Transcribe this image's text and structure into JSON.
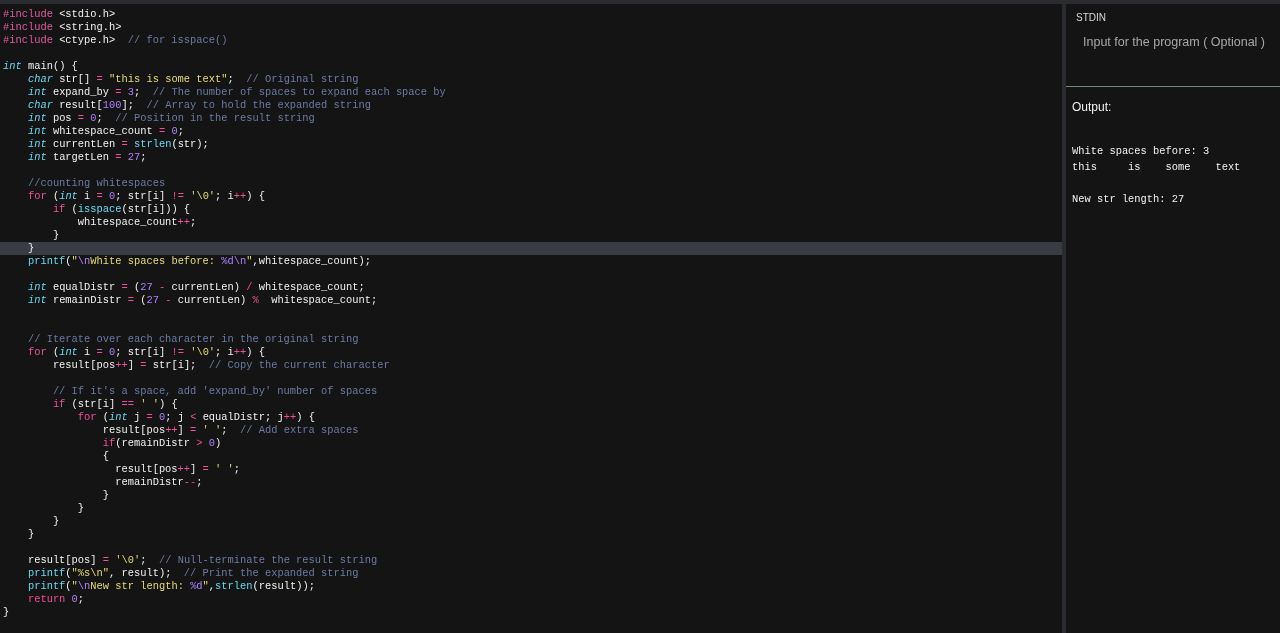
{
  "editor": {
    "lines": [
      {
        "highlighted": false,
        "tokens": [
          {
            "kind": "pp",
            "text": "#include"
          },
          {
            "kind": "plain",
            "text": " <stdio.h>"
          }
        ]
      },
      {
        "highlighted": false,
        "tokens": [
          {
            "kind": "pp",
            "text": "#include"
          },
          {
            "kind": "plain",
            "text": " <string.h>"
          }
        ]
      },
      {
        "highlighted": false,
        "tokens": [
          {
            "kind": "pp",
            "text": "#include"
          },
          {
            "kind": "plain",
            "text": " <ctype.h>  "
          },
          {
            "kind": "comment",
            "text": "// for isspace()"
          }
        ]
      },
      {
        "highlighted": false
      },
      {
        "highlighted": false,
        "tokens": [
          {
            "kind": "type",
            "text": "int"
          },
          {
            "kind": "plain",
            "text": " main() {"
          }
        ]
      },
      {
        "highlighted": false,
        "tokens": [
          {
            "kind": "type",
            "text": "    char"
          },
          {
            "kind": "plain",
            "text": " str[] "
          },
          {
            "kind": "op",
            "text": "="
          },
          {
            "kind": "string",
            "text": " \"this is some text\""
          },
          {
            "kind": "plain",
            "text": ";  "
          },
          {
            "kind": "comment",
            "text": "// Original string"
          }
        ]
      },
      {
        "highlighted": false,
        "tokens": [
          {
            "kind": "type",
            "text": "    int"
          },
          {
            "kind": "plain",
            "text": " expand_by "
          },
          {
            "kind": "op",
            "text": "="
          },
          {
            "kind": "number",
            "text": " 3"
          },
          {
            "kind": "plain",
            "text": ";  "
          },
          {
            "kind": "comment",
            "text": "// The number of spaces to expand each space by"
          }
        ]
      },
      {
        "highlighted": false,
        "tokens": [
          {
            "kind": "type",
            "text": "    char"
          },
          {
            "kind": "plain",
            "text": " result["
          },
          {
            "kind": "number",
            "text": "100"
          },
          {
            "kind": "plain",
            "text": "];  "
          },
          {
            "kind": "comment",
            "text": "// Array to hold the expanded string"
          }
        ]
      },
      {
        "highlighted": false,
        "tokens": [
          {
            "kind": "type",
            "text": "    int"
          },
          {
            "kind": "plain",
            "text": " pos "
          },
          {
            "kind": "op",
            "text": "="
          },
          {
            "kind": "number",
            "text": " 0"
          },
          {
            "kind": "plain",
            "text": ";  "
          },
          {
            "kind": "comment",
            "text": "// Position in the result string"
          }
        ]
      },
      {
        "highlighted": false,
        "tokens": [
          {
            "kind": "type",
            "text": "    int"
          },
          {
            "kind": "plain",
            "text": " whitespace_count "
          },
          {
            "kind": "op",
            "text": "="
          },
          {
            "kind": "number",
            "text": " 0"
          },
          {
            "kind": "plain",
            "text": ";"
          }
        ]
      },
      {
        "highlighted": false,
        "tokens": [
          {
            "kind": "type",
            "text": "    int"
          },
          {
            "kind": "plain",
            "text": " currentLen "
          },
          {
            "kind": "op",
            "text": "="
          },
          {
            "kind": "function",
            "text": " strlen"
          },
          {
            "kind": "plain",
            "text": "(str);"
          }
        ]
      },
      {
        "highlighted": false,
        "tokens": [
          {
            "kind": "type",
            "text": "    int"
          },
          {
            "kind": "plain",
            "text": " targetLen "
          },
          {
            "kind": "op",
            "text": "="
          },
          {
            "kind": "number",
            "text": " 27"
          },
          {
            "kind": "plain",
            "text": ";"
          }
        ]
      },
      {
        "highlighted": false
      },
      {
        "highlighted": false,
        "tokens": [
          {
            "kind": "comment",
            "text": "    //counting whitespaces"
          }
        ]
      },
      {
        "highlighted": false,
        "tokens": [
          {
            "kind": "keyword",
            "text": "    for"
          },
          {
            "kind": "plain",
            "text": " ("
          },
          {
            "kind": "type",
            "text": "int"
          },
          {
            "kind": "plain",
            "text": " i "
          },
          {
            "kind": "op",
            "text": "="
          },
          {
            "kind": "number",
            "text": " 0"
          },
          {
            "kind": "plain",
            "text": "; str[i] "
          },
          {
            "kind": "op",
            "text": "!="
          },
          {
            "kind": "string",
            "text": " '\\0'"
          },
          {
            "kind": "plain",
            "text": "; i"
          },
          {
            "kind": "op",
            "text": "++"
          },
          {
            "kind": "plain",
            "text": ") {"
          }
        ]
      },
      {
        "highlighted": false,
        "tokens": [
          {
            "kind": "keyword",
            "text": "        if"
          },
          {
            "kind": "plain",
            "text": " ("
          },
          {
            "kind": "function",
            "text": "isspace"
          },
          {
            "kind": "plain",
            "text": "(str[i])) {"
          }
        ]
      },
      {
        "highlighted": false,
        "tokens": [
          {
            "kind": "plain",
            "text": "            whitespace_count"
          },
          {
            "kind": "op",
            "text": "++"
          },
          {
            "kind": "plain",
            "text": ";"
          }
        ]
      },
      {
        "highlighted": false,
        "tokens": [
          {
            "kind": "plain",
            "text": "        }"
          }
        ]
      },
      {
        "highlighted": true,
        "tokens": [
          {
            "kind": "plain",
            "text": "    }"
          }
        ]
      },
      {
        "highlighted": false,
        "tokens": [
          {
            "kind": "function",
            "text": "    printf"
          },
          {
            "kind": "plain",
            "text": "("
          },
          {
            "kind": "string",
            "text": "\""
          },
          {
            "kind": "escape",
            "text": "\\n"
          },
          {
            "kind": "string",
            "text": "White spaces before: "
          },
          {
            "kind": "escape",
            "text": "%d\\n"
          },
          {
            "kind": "string",
            "text": "\""
          },
          {
            "kind": "plain",
            "text": ",whitespace_count);"
          }
        ]
      },
      {
        "highlighted": false
      },
      {
        "highlighted": false,
        "tokens": [
          {
            "kind": "type",
            "text": "    int"
          },
          {
            "kind": "plain",
            "text": " equalDistr "
          },
          {
            "kind": "op",
            "text": "="
          },
          {
            "kind": "plain",
            "text": " ("
          },
          {
            "kind": "number",
            "text": "27"
          },
          {
            "kind": "op",
            "text": " -"
          },
          {
            "kind": "plain",
            "text": " currentLen) "
          },
          {
            "kind": "op",
            "text": "/"
          },
          {
            "kind": "plain",
            "text": " whitespace_count;"
          }
        ]
      },
      {
        "highlighted": false,
        "tokens": [
          {
            "kind": "type",
            "text": "    int"
          },
          {
            "kind": "plain",
            "text": " remainDistr "
          },
          {
            "kind": "op",
            "text": "="
          },
          {
            "kind": "plain",
            "text": " ("
          },
          {
            "kind": "number",
            "text": "27"
          },
          {
            "kind": "op",
            "text": " -"
          },
          {
            "kind": "plain",
            "text": " currentLen) "
          },
          {
            "kind": "op",
            "text": "%"
          },
          {
            "kind": "plain",
            "text": "  whitespace_count;"
          }
        ]
      },
      {
        "highlighted": false
      },
      {
        "highlighted": false
      },
      {
        "highlighted": false,
        "tokens": [
          {
            "kind": "comment",
            "text": "    // Iterate over each character in the original string"
          }
        ]
      },
      {
        "highlighted": false,
        "tokens": [
          {
            "kind": "keyword",
            "text": "    for"
          },
          {
            "kind": "plain",
            "text": " ("
          },
          {
            "kind": "type",
            "text": "int"
          },
          {
            "kind": "plain",
            "text": " i "
          },
          {
            "kind": "op",
            "text": "="
          },
          {
            "kind": "number",
            "text": " 0"
          },
          {
            "kind": "plain",
            "text": "; str[i] "
          },
          {
            "kind": "op",
            "text": "!="
          },
          {
            "kind": "string",
            "text": " '\\0'"
          },
          {
            "kind": "plain",
            "text": "; i"
          },
          {
            "kind": "op",
            "text": "++"
          },
          {
            "kind": "plain",
            "text": ") {"
          }
        ]
      },
      {
        "highlighted": false,
        "tokens": [
          {
            "kind": "plain",
            "text": "        result[pos"
          },
          {
            "kind": "op",
            "text": "++"
          },
          {
            "kind": "plain",
            "text": "] "
          },
          {
            "kind": "op",
            "text": "="
          },
          {
            "kind": "plain",
            "text": " str[i];  "
          },
          {
            "kind": "comment",
            "text": "// Copy the current character"
          }
        ]
      },
      {
        "highlighted": false
      },
      {
        "highlighted": false,
        "tokens": [
          {
            "kind": "comment",
            "text": "        // If it's a space, add 'expand_by' number of spaces"
          }
        ]
      },
      {
        "highlighted": false,
        "tokens": [
          {
            "kind": "keyword",
            "text": "        if"
          },
          {
            "kind": "plain",
            "text": " (str[i] "
          },
          {
            "kind": "op",
            "text": "=="
          },
          {
            "kind": "string",
            "text": " ' '"
          },
          {
            "kind": "plain",
            "text": ") {"
          }
        ]
      },
      {
        "highlighted": false,
        "tokens": [
          {
            "kind": "keyword",
            "text": "            for"
          },
          {
            "kind": "plain",
            "text": " ("
          },
          {
            "kind": "type",
            "text": "int"
          },
          {
            "kind": "plain",
            "text": " j "
          },
          {
            "kind": "op",
            "text": "="
          },
          {
            "kind": "number",
            "text": " 0"
          },
          {
            "kind": "plain",
            "text": "; j "
          },
          {
            "kind": "op",
            "text": "<"
          },
          {
            "kind": "plain",
            "text": " equalDistr; j"
          },
          {
            "kind": "op",
            "text": "++"
          },
          {
            "kind": "plain",
            "text": ") {"
          }
        ]
      },
      {
        "highlighted": false,
        "tokens": [
          {
            "kind": "plain",
            "text": "                result[pos"
          },
          {
            "kind": "op",
            "text": "++"
          },
          {
            "kind": "plain",
            "text": "] "
          },
          {
            "kind": "op",
            "text": "="
          },
          {
            "kind": "string",
            "text": " ' '"
          },
          {
            "kind": "plain",
            "text": ";  "
          },
          {
            "kind": "comment",
            "text": "// Add extra spaces"
          }
        ]
      },
      {
        "highlighted": false,
        "tokens": [
          {
            "kind": "keyword",
            "text": "                if"
          },
          {
            "kind": "plain",
            "text": "(remainDistr "
          },
          {
            "kind": "op",
            "text": ">"
          },
          {
            "kind": "number",
            "text": " 0"
          },
          {
            "kind": "plain",
            "text": ")"
          }
        ]
      },
      {
        "highlighted": false,
        "tokens": [
          {
            "kind": "plain",
            "text": "                {"
          }
        ]
      },
      {
        "highlighted": false,
        "tokens": [
          {
            "kind": "plain",
            "text": "                  result[pos"
          },
          {
            "kind": "op",
            "text": "++"
          },
          {
            "kind": "plain",
            "text": "] "
          },
          {
            "kind": "op",
            "text": "="
          },
          {
            "kind": "string",
            "text": " ' '"
          },
          {
            "kind": "plain",
            "text": ";"
          }
        ]
      },
      {
        "highlighted": false,
        "tokens": [
          {
            "kind": "plain",
            "text": "                  remainDistr"
          },
          {
            "kind": "op",
            "text": "--"
          },
          {
            "kind": "plain",
            "text": ";"
          }
        ]
      },
      {
        "highlighted": false,
        "tokens": [
          {
            "kind": "plain",
            "text": "                }"
          }
        ]
      },
      {
        "highlighted": false,
        "tokens": [
          {
            "kind": "plain",
            "text": "            }"
          }
        ]
      },
      {
        "highlighted": false,
        "tokens": [
          {
            "kind": "plain",
            "text": "        }"
          }
        ]
      },
      {
        "highlighted": false,
        "tokens": [
          {
            "kind": "plain",
            "text": "    }"
          }
        ]
      },
      {
        "highlighted": false
      },
      {
        "highlighted": false,
        "tokens": [
          {
            "kind": "plain",
            "text": "    result[pos] "
          },
          {
            "kind": "op",
            "text": "="
          },
          {
            "kind": "string",
            "text": " '\\0'"
          },
          {
            "kind": "plain",
            "text": ";  "
          },
          {
            "kind": "comment",
            "text": "// Null-terminate the result string"
          }
        ]
      },
      {
        "highlighted": false,
        "tokens": [
          {
            "kind": "function",
            "text": "    printf"
          },
          {
            "kind": "plain",
            "text": "("
          },
          {
            "kind": "string",
            "text": "\"%s\\n\""
          },
          {
            "kind": "plain",
            "text": ", result);  "
          },
          {
            "kind": "comment",
            "text": "// Print the expanded string"
          }
        ]
      },
      {
        "highlighted": false,
        "tokens": [
          {
            "kind": "function",
            "text": "    printf"
          },
          {
            "kind": "plain",
            "text": "("
          },
          {
            "kind": "string",
            "text": "\""
          },
          {
            "kind": "escape",
            "text": "\\n"
          },
          {
            "kind": "string",
            "text": "New str length: "
          },
          {
            "kind": "escape",
            "text": "%d"
          },
          {
            "kind": "string",
            "text": "\""
          },
          {
            "kind": "plain",
            "text": ","
          },
          {
            "kind": "function",
            "text": "strlen"
          },
          {
            "kind": "plain",
            "text": "(result));"
          }
        ]
      },
      {
        "highlighted": false,
        "tokens": [
          {
            "kind": "keyword",
            "text": "    return"
          },
          {
            "kind": "number",
            "text": " 0"
          },
          {
            "kind": "plain",
            "text": ";"
          }
        ]
      },
      {
        "highlighted": false,
        "tokens": [
          {
            "kind": "plain",
            "text": "}"
          }
        ]
      }
    ]
  },
  "stdin": {
    "label": "STDIN",
    "placeholder": "Input for the program ( Optional )"
  },
  "output": {
    "label": "Output:",
    "text": "White spaces before: 3\nthis     is    some    text\n\nNew str length: 27"
  }
}
